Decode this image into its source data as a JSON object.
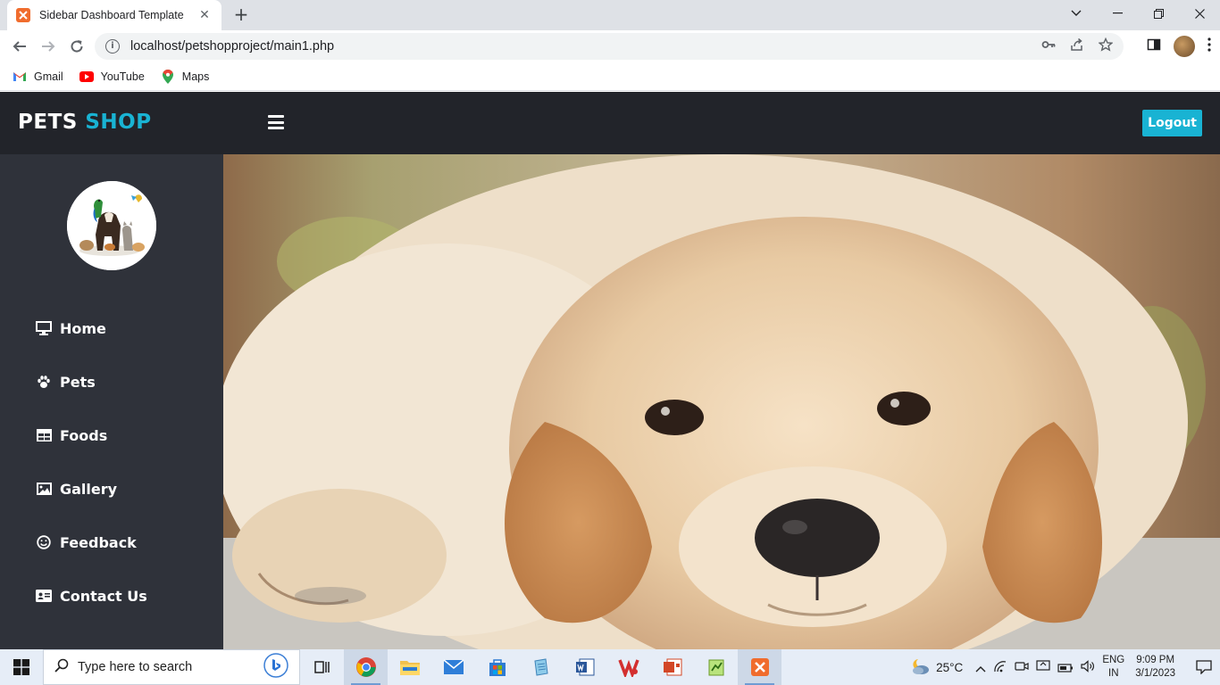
{
  "browser": {
    "tab_title": "Sidebar Dashboard Template",
    "url": "localhost/petshopproject/main1.php",
    "bookmarks": [
      {
        "label": "Gmail",
        "icon": "gmail-icon"
      },
      {
        "label": "YouTube",
        "icon": "youtube-icon"
      },
      {
        "label": "Maps",
        "icon": "maps-icon"
      }
    ]
  },
  "header": {
    "brand_pets": "PETS",
    "brand_shop": "SHOP",
    "logout_label": "Logout"
  },
  "sidebar": {
    "items": [
      {
        "label": "Home",
        "icon": "desktop-icon"
      },
      {
        "label": "Pets",
        "icon": "paw-icon"
      },
      {
        "label": "Foods",
        "icon": "grid-icon"
      },
      {
        "label": "Gallery",
        "icon": "image-icon"
      },
      {
        "label": "Feedback",
        "icon": "smile-icon"
      },
      {
        "label": "Contact Us",
        "icon": "id-card-icon"
      }
    ]
  },
  "main": {
    "hero_image": "golden-retriever-puppy-photo"
  },
  "taskbar": {
    "search_placeholder": "Type here to search",
    "temperature": "25°C",
    "lang_line1": "ENG",
    "lang_line2": "IN",
    "time": "9:09 PM",
    "date": "3/1/2023"
  },
  "colors": {
    "header_bg": "#22242a",
    "sidebar_bg": "#2f323a",
    "accent": "#19b3d3"
  }
}
